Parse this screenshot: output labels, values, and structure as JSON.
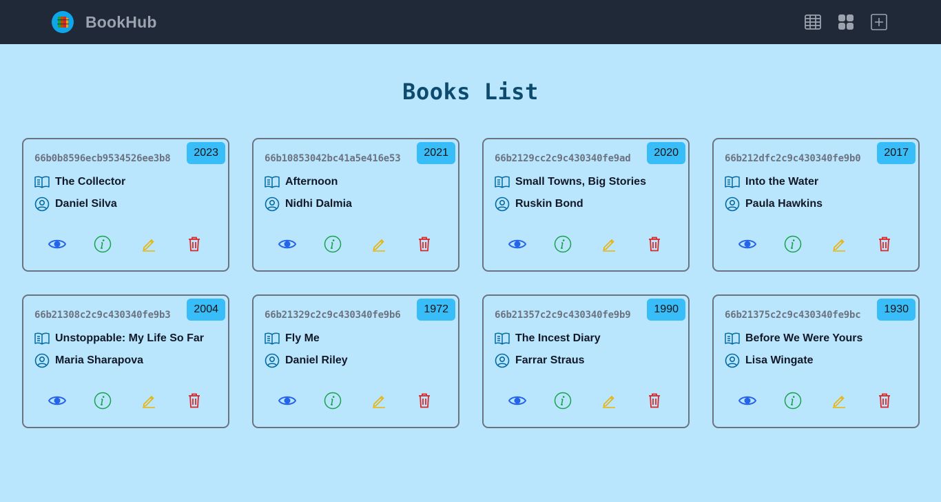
{
  "nav": {
    "brand": "BookHub",
    "icons": [
      "table-view-icon",
      "card-view-icon",
      "add-book-icon"
    ]
  },
  "page": {
    "title": "Books List"
  },
  "colors": {
    "navbar": "#1f2937",
    "background": "#bae6fd",
    "title": "#0c4a6e",
    "badge": "#38bdf8",
    "view": "#2563eb",
    "info": "#16a34a",
    "edit": "#eab308",
    "delete": "#dc2626"
  },
  "books": [
    {
      "id": "66b0b8596ecb9534526ee3b8",
      "year": "2023",
      "title": "The Collector",
      "author": "Daniel Silva"
    },
    {
      "id": "66b10853042bc41a5e416e53",
      "year": "2021",
      "title": "Afternoon",
      "author": "Nidhi Dalmia"
    },
    {
      "id": "66b2129cc2c9c430340fe9ad",
      "year": "2020",
      "title": "Small Towns, Big Stories",
      "author": "Ruskin Bond"
    },
    {
      "id": "66b212dfc2c9c430340fe9b0",
      "year": "2017",
      "title": "Into the Water",
      "author": "Paula Hawkins"
    },
    {
      "id": "66b21308c2c9c430340fe9b3",
      "year": "2004",
      "title": "Unstoppable: My Life So Far",
      "author": "Maria Sharapova"
    },
    {
      "id": "66b21329c2c9c430340fe9b6",
      "year": "1972",
      "title": "Fly Me",
      "author": "Daniel Riley"
    },
    {
      "id": "66b21357c2c9c430340fe9b9",
      "year": "1990",
      "title": "The Incest Diary",
      "author": "Farrar Straus"
    },
    {
      "id": "66b21375c2c9c430340fe9bc",
      "year": "1930",
      "title": "Before We Were Yours",
      "author": "Lisa Wingate"
    }
  ]
}
